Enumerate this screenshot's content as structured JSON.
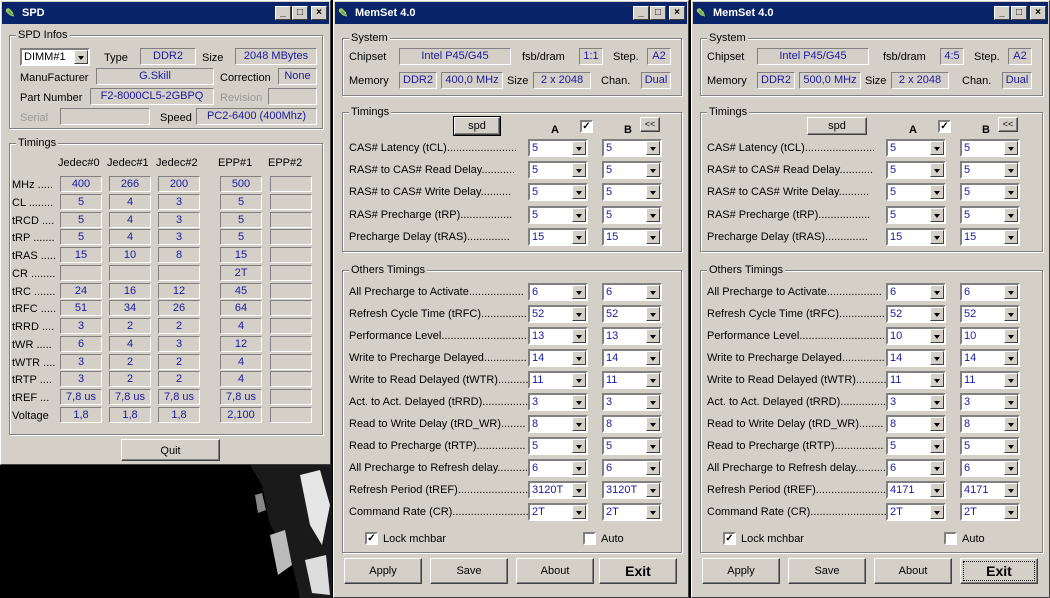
{
  "spd": {
    "title": "SPD",
    "infos_label": "SPD Infos",
    "dimm": "DIMM#1",
    "type_label": "Type",
    "type": "DDR2",
    "size_label": "Size",
    "size": "2048 MBytes",
    "manuf_label": "ManuFacturer",
    "manuf": "G.Skill",
    "correction_label": "Correction",
    "correction": "None",
    "part_label": "Part Number",
    "part": "F2-8000CL5-2GBPQ",
    "revision_label": "Revision",
    "serial_label": "Serial",
    "speed_label": "Speed",
    "speed": "PC2-6400 (400Mhz)",
    "timings_label": "Timings",
    "columns": [
      "Jedec#0",
      "Jedec#1",
      "Jedec#2",
      "EPP#1",
      "EPP#2"
    ],
    "rows": [
      {
        "label": "MHz .....",
        "cells": [
          "400",
          "266",
          "200",
          "500",
          ""
        ]
      },
      {
        "label": "CL ........",
        "cells": [
          "5",
          "4",
          "3",
          "5",
          ""
        ]
      },
      {
        "label": "tRCD ....",
        "cells": [
          "5",
          "4",
          "3",
          "5",
          ""
        ]
      },
      {
        "label": "tRP .......",
        "cells": [
          "5",
          "4",
          "3",
          "5",
          ""
        ]
      },
      {
        "label": "tRAS .....",
        "cells": [
          "15",
          "10",
          "8",
          "15",
          ""
        ]
      },
      {
        "label": "CR ........",
        "cells": [
          "",
          "",
          "",
          "2T",
          ""
        ]
      },
      {
        "label": "tRC .......",
        "cells": [
          "24",
          "16",
          "12",
          "45",
          ""
        ]
      },
      {
        "label": "tRFC .....",
        "cells": [
          "51",
          "34",
          "26",
          "64",
          ""
        ]
      },
      {
        "label": "tRRD ....",
        "cells": [
          "3",
          "2",
          "2",
          "4",
          ""
        ]
      },
      {
        "label": "tWR .....",
        "cells": [
          "6",
          "4",
          "3",
          "12",
          ""
        ]
      },
      {
        "label": "tWTR ....",
        "cells": [
          "3",
          "2",
          "2",
          "4",
          ""
        ]
      },
      {
        "label": "tRTP ....",
        "cells": [
          "3",
          "2",
          "2",
          "4",
          ""
        ]
      },
      {
        "label": "tREF ...",
        "cells": [
          "7,8 us",
          "7,8 us",
          "7,8 us",
          "7,8 us",
          ""
        ]
      },
      {
        "label": "Voltage",
        "cells": [
          "1,8",
          "1,8",
          "1,8",
          "2,100",
          ""
        ]
      }
    ],
    "quit": "Quit"
  },
  "memset1": {
    "title": "MemSet 4.0",
    "system_label": "System",
    "chipset_label": "Chipset",
    "chipset": "Intel P45/G45",
    "fsb_label": "fsb/dram",
    "fsb": "1:1",
    "step_label": "Step.",
    "step": "A2",
    "memory_label": "Memory",
    "memory_type": "DDR2",
    "memory_freq": "400,0 MHz",
    "size_label": "Size",
    "size": "2 x 2048",
    "chan_label": "Chan.",
    "chan": "Dual",
    "timings_label": "Timings",
    "spd_button": "spd",
    "col_a": "A",
    "col_b": "B",
    "collapse": "<<",
    "link_check": "✓",
    "timings": [
      {
        "label": "CAS# Latency (tCL).......................",
        "a": "5",
        "b": "5"
      },
      {
        "label": "RAS# to CAS# Read Delay...........",
        "a": "5",
        "b": "5"
      },
      {
        "label": "RAS# to CAS# Write Delay..........",
        "a": "5",
        "b": "5"
      },
      {
        "label": "RAS# Precharge (tRP).................",
        "a": "5",
        "b": "5"
      },
      {
        "label": "Precharge Delay  (tRAS)..............",
        "a": "15",
        "b": "15"
      }
    ],
    "others_label": "Others Timings",
    "others": [
      {
        "label": "All Precharge to Activate..................",
        "a": "6",
        "b": "6"
      },
      {
        "label": "Refresh Cycle Time (tRFC)...............",
        "a": "52",
        "b": "52"
      },
      {
        "label": "Performance Level.............................",
        "a": "13",
        "b": "13"
      },
      {
        "label": "Write to Precharge Delayed..............",
        "a": "14",
        "b": "14"
      },
      {
        "label": "Write to Read Delayed (tWTR)..........",
        "a": "11",
        "b": "11"
      },
      {
        "label": "Act. to Act. Delayed (tRRD)...............",
        "a": "3",
        "b": "3"
      },
      {
        "label": "Read to Write Delay (tRD_WR)........",
        "a": "8",
        "b": "8"
      },
      {
        "label": "Read to Precharge (tRTP)................",
        "a": "5",
        "b": "5"
      },
      {
        "label": "All Precharge to Refresh delay..........",
        "a": "6",
        "b": "6"
      },
      {
        "label": "Refresh Period (tREF)........................",
        "a": "3120T",
        "b": "3120T"
      },
      {
        "label": "Command Rate (CR)..........................",
        "a": "2T",
        "b": "2T"
      }
    ],
    "lock_label": "Lock mchbar",
    "lock_check": "✓",
    "auto_label": "Auto",
    "apply": "Apply",
    "save": "Save",
    "about": "About",
    "exit": "Exit"
  },
  "memset2": {
    "title": "MemSet 4.0",
    "system_label": "System",
    "chipset_label": "Chipset",
    "chipset": "Intel P45/G45",
    "fsb_label": "fsb/dram",
    "fsb": "4:5",
    "step_label": "Step.",
    "step": "A2",
    "memory_label": "Memory",
    "memory_type": "DDR2",
    "memory_freq": "500,0 MHz",
    "size_label": "Size",
    "size": "2 x 2048",
    "chan_label": "Chan.",
    "chan": "Dual",
    "timings_label": "Timings",
    "spd_button": "spd",
    "col_a": "A",
    "col_b": "B",
    "collapse": "<<",
    "link_check": "✓",
    "timings": [
      {
        "label": "CAS# Latency (tCL).......................",
        "a": "5",
        "b": "5"
      },
      {
        "label": "RAS# to CAS# Read Delay...........",
        "a": "5",
        "b": "5"
      },
      {
        "label": "RAS# to CAS# Write Delay..........",
        "a": "5",
        "b": "5"
      },
      {
        "label": "RAS# Precharge (tRP).................",
        "a": "5",
        "b": "5"
      },
      {
        "label": "Precharge Delay  (tRAS)..............",
        "a": "15",
        "b": "15"
      }
    ],
    "others_label": "Others Timings",
    "others": [
      {
        "label": "All Precharge to Activate..................",
        "a": "6",
        "b": "6"
      },
      {
        "label": "Refresh Cycle Time (tRFC)...............",
        "a": "52",
        "b": "52"
      },
      {
        "label": "Performance Level.............................",
        "a": "10",
        "b": "10"
      },
      {
        "label": "Write to Precharge Delayed..............",
        "a": "14",
        "b": "14"
      },
      {
        "label": "Write to Read Delayed (tWTR)..........",
        "a": "11",
        "b": "11"
      },
      {
        "label": "Act. to Act. Delayed (tRRD)...............",
        "a": "3",
        "b": "3"
      },
      {
        "label": "Read to Write Delay (tRD_WR)........",
        "a": "8",
        "b": "8"
      },
      {
        "label": "Read to Precharge (tRTP)................",
        "a": "5",
        "b": "5"
      },
      {
        "label": "All Precharge to Refresh delay..........",
        "a": "6",
        "b": "6"
      },
      {
        "label": "Refresh Period (tREF)........................",
        "a": "4171",
        "b": "4171"
      },
      {
        "label": "Command Rate (CR)..........................",
        "a": "2T",
        "b": "2T"
      }
    ],
    "lock_label": "Lock mchbar",
    "lock_check": "✓",
    "auto_label": "Auto",
    "apply": "Apply",
    "save": "Save",
    "about": "About",
    "exit": "Exit"
  }
}
